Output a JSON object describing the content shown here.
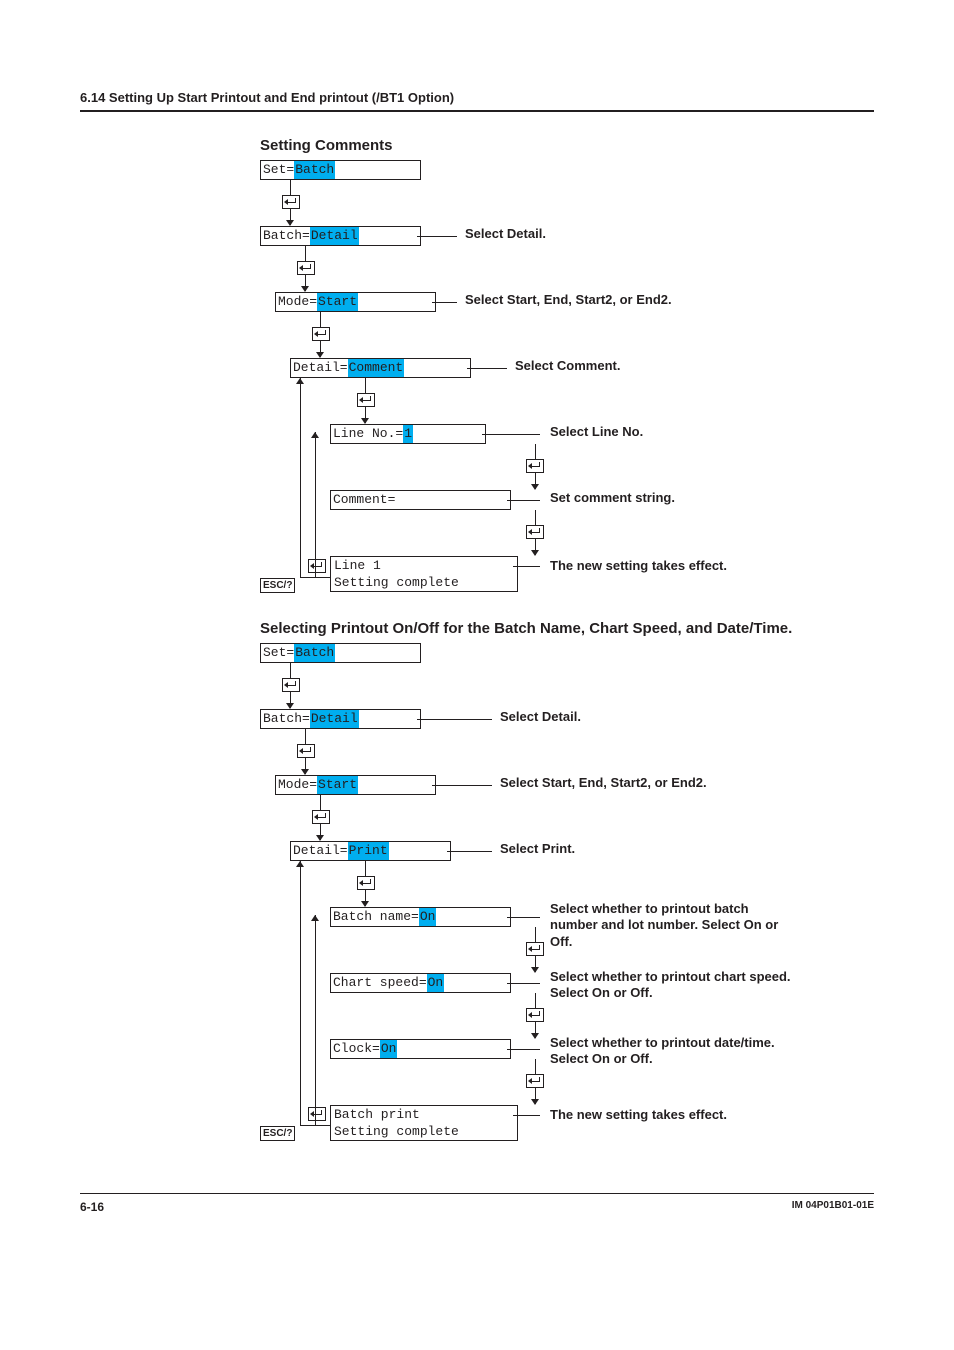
{
  "header": {
    "section": "6.14  Setting Up Start Printout and End printout (/BT1 Option)"
  },
  "proc1": {
    "title": "Setting Comments",
    "steps": {
      "set_label": "Set=",
      "set_val": "Batch",
      "batch_label": "Batch=",
      "batch_val": "Detail",
      "batch_desc": "Select Detail.",
      "mode_label": "Mode=",
      "mode_val": "Start",
      "mode_desc": "Select Start, End, Start2, or End2.",
      "detail_label": "Detail=",
      "detail_val": "Comment",
      "detail_desc": "Select Comment.",
      "lineno_label": "Line No.=",
      "lineno_val": "1",
      "lineno_desc": "Select Line No.",
      "comment_label": "Comment=",
      "comment_val": " ",
      "comment_desc": "Set comment string.",
      "final_l1": "Line 1",
      "final_l2": "Setting complete",
      "final_desc": "The new setting takes effect."
    },
    "esc": "ESC/?"
  },
  "proc2": {
    "title": "Selecting Printout On/Off for the Batch Name, Chart Speed, and Date/Time.",
    "steps": {
      "set_label": "Set=",
      "set_val": "Batch",
      "batch_label": "Batch=",
      "batch_val": "Detail",
      "batch_desc": "Select Detail.",
      "mode_label": "Mode=",
      "mode_val": "Start",
      "mode_desc": "Select Start, End, Start2, or End2.",
      "detail_label": "Detail=",
      "detail_val": "Print",
      "detail_desc": "Select Print.",
      "bn_label": "Batch name=",
      "bn_val": "On",
      "bn_desc": "Select whether to printout batch number and lot number. Select On or Off.",
      "cs_label": "Chart speed=",
      "cs_val": "On",
      "cs_desc": "Select whether to printout chart speed. Select On or Off.",
      "clk_label": "Clock=",
      "clk_val": "On",
      "clk_desc": "Select whether to printout date/time. Select On or Off.",
      "final_l1": "Batch print",
      "final_l2": "Setting complete",
      "final_desc": "The new setting takes effect."
    },
    "esc": "ESC/?"
  },
  "footer": {
    "page": "6-16",
    "doc_id": "IM 04P01B01-01E"
  }
}
